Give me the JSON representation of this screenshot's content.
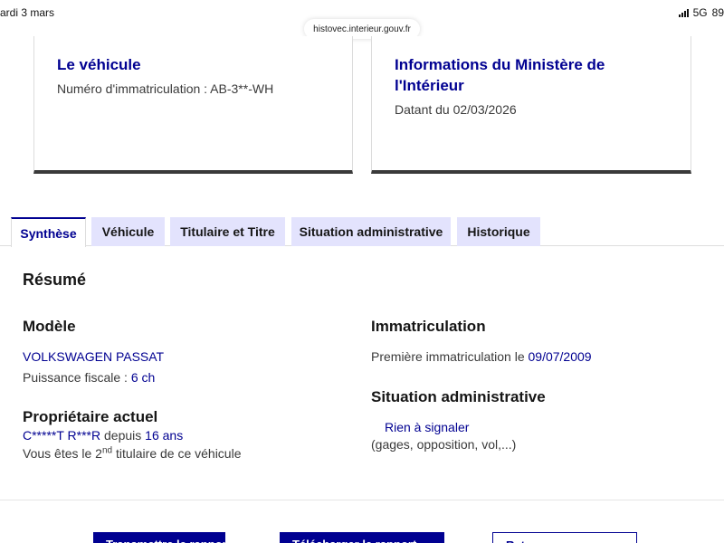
{
  "status_bar": {
    "time": "ardi 3 mars",
    "network": "5G",
    "battery": "89"
  },
  "browser": {
    "url": "histovec.interieur.gouv.fr"
  },
  "cards": {
    "vehicle": {
      "title": "Le véhicule",
      "plate_text": "Numéro d'immatriculation : AB-3**-WH"
    },
    "ministry": {
      "title": "Informations du Ministère de l'Intérieur",
      "date_text": "Datant du 02/03/2026"
    }
  },
  "tabs": [
    {
      "label": "Synthèse",
      "active": true
    },
    {
      "label": "Véhicule",
      "active": false
    },
    {
      "label": "Titulaire et Titre",
      "active": false
    },
    {
      "label": "Situation administrative",
      "active": false
    },
    {
      "label": "Historique",
      "active": false
    }
  ],
  "summary": {
    "heading": "Résumé",
    "model": {
      "heading": "Modèle",
      "name": "VOLKSWAGEN PASSAT",
      "power_label": "Puissance fiscale : ",
      "power_value": "6 ch"
    },
    "owner": {
      "heading": "Propriétaire actuel",
      "name": "C*****T R***R",
      "since_label": " depuis ",
      "since_value": "16 ans",
      "rank_prefix": "Vous êtes le 2",
      "rank_sup": "nd",
      "rank_suffix": " titulaire de ce véhicule"
    },
    "registration": {
      "heading": "Immatriculation",
      "first_label": "Première immatriculation le ",
      "first_date": "09/07/2009"
    },
    "admin": {
      "heading": "Situation administrative",
      "status": "Rien à signaler",
      "details": "(gages, opposition, vol,...)"
    }
  },
  "actions": {
    "btn1": "Transmettre le rapport",
    "btn2": "Télécharger le rapport",
    "btn3": "Retour"
  },
  "colors": {
    "accent": "#000091",
    "tab_inactive": "#e3e3fd"
  }
}
